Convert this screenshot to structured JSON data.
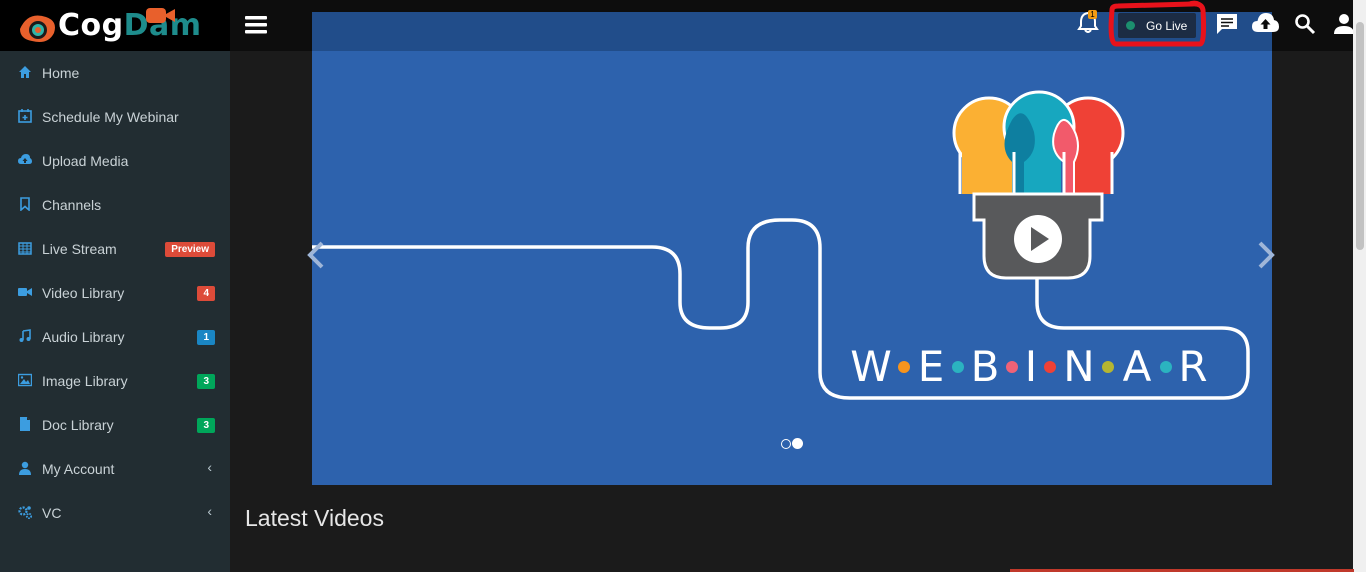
{
  "brand": {
    "part1": "Cog",
    "part2": "Dam"
  },
  "sidebar": {
    "items": [
      {
        "label": "Home",
        "icon": "home-icon"
      },
      {
        "label": "Schedule My Webinar",
        "icon": "calendar-plus-icon"
      },
      {
        "label": "Upload Media",
        "icon": "cloud-upload-icon"
      },
      {
        "label": "Channels",
        "icon": "bookmark-icon"
      },
      {
        "label": "Live Stream",
        "icon": "calendar-grid-icon",
        "badge": "Preview",
        "badge_color": "#dd4b39"
      },
      {
        "label": "Video Library",
        "icon": "video-camera-icon",
        "badge": "4",
        "badge_color": "#dd4b39"
      },
      {
        "label": "Audio Library",
        "icon": "music-note-icon",
        "badge": "1",
        "badge_color": "#1a86c4"
      },
      {
        "label": "Image Library",
        "icon": "image-icon",
        "badge": "3",
        "badge_color": "#00a65a"
      },
      {
        "label": "Doc Library",
        "icon": "document-icon",
        "badge": "3",
        "badge_color": "#00a65a"
      },
      {
        "label": "My Account",
        "icon": "user-icon",
        "chevron": "‹"
      },
      {
        "label": "VC",
        "icon": "gears-icon",
        "chevron": "‹"
      }
    ],
    "icon_color": "#3c9de0"
  },
  "topbar": {
    "go_live_label": "Go Live",
    "notification_count": "1"
  },
  "banner": {
    "letters": [
      "W",
      "E",
      "B",
      "I",
      "N",
      "A",
      "R"
    ],
    "dot_colors": [
      "#f7941d",
      "#2bb3c0",
      "#2bb3c0",
      "#f06277",
      "#ef4136",
      "#b5b631",
      "#2bb3c0"
    ]
  },
  "main": {
    "section_title": "Latest Videos"
  }
}
